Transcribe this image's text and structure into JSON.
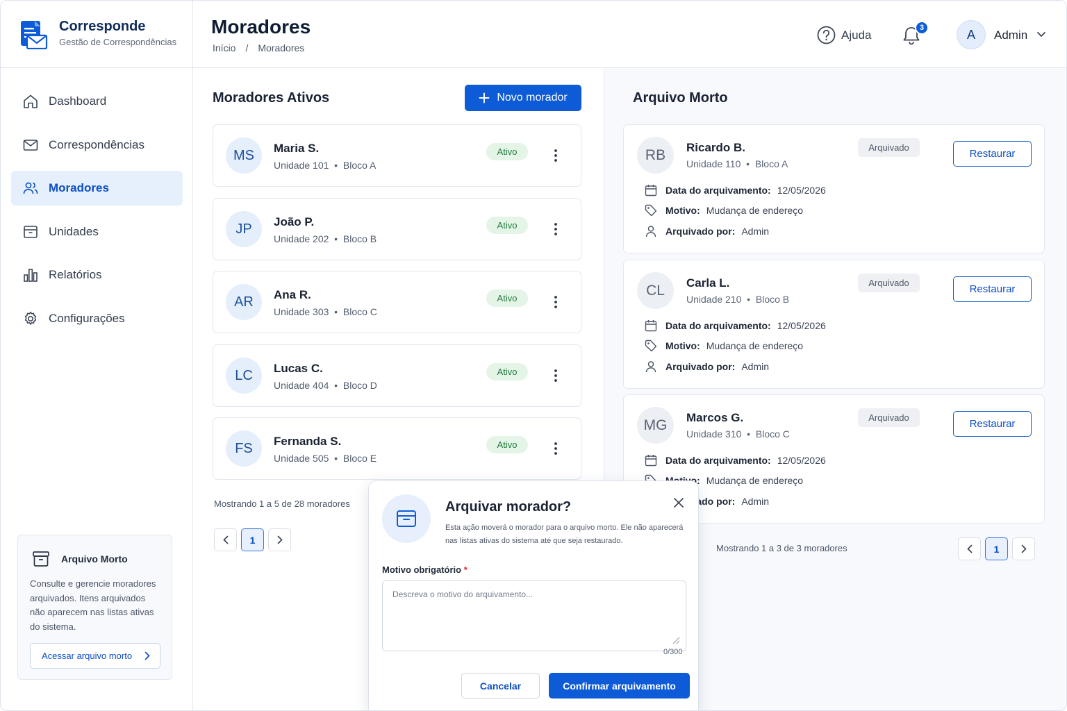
{
  "brand": {
    "name": "Corresponde",
    "subtitle": "Gestão de Correspondências"
  },
  "header": {
    "title": "Moradores",
    "breadcrumb": [
      "Início",
      "/",
      "Moradores"
    ],
    "help_label": "Ajuda",
    "notifications_count": "3",
    "user_initial": "A",
    "user_name": "Admin"
  },
  "sidebar": {
    "items": [
      {
        "label": "Dashboard",
        "icon": "home-icon",
        "active": false
      },
      {
        "label": "Correspondências",
        "icon": "mail-icon",
        "active": false
      },
      {
        "label": "Moradores",
        "icon": "users-icon",
        "active": true
      },
      {
        "label": "Unidades",
        "icon": "box-icon",
        "active": false
      },
      {
        "label": "Relatórios",
        "icon": "bar-chart-icon",
        "active": false
      },
      {
        "label": "Configurações",
        "icon": "gear-icon",
        "active": false
      }
    ],
    "archive_card": {
      "title": "Arquivo Morto",
      "text": "Consulte e gerencie moradores arquivados. Itens arquivados não aparecem nas listas ativas do sistema.",
      "link": "Acessar arquivo morto"
    }
  },
  "active_list": {
    "title": "Moradores Ativos",
    "new_button": "Novo morador",
    "residents": [
      {
        "initials": "MS",
        "name": "Maria S.",
        "unit": "Unidade 101",
        "block": "Bloco A",
        "status": "Ativo"
      },
      {
        "initials": "JP",
        "name": "João P.",
        "unit": "Unidade 202",
        "block": "Bloco B",
        "status": "Ativo"
      },
      {
        "initials": "AR",
        "name": "Ana R.",
        "unit": "Unidade 303",
        "block": "Bloco C",
        "status": "Ativo"
      },
      {
        "initials": "LC",
        "name": "Lucas C.",
        "unit": "Unidade 404",
        "block": "Bloco D",
        "status": "Ativo"
      },
      {
        "initials": "FS",
        "name": "Fernanda S.",
        "unit": "Unidade 505",
        "block": "Bloco E",
        "status": "Ativo"
      }
    ],
    "footer": "Mostrando 1 a 5 de 28 moradores",
    "page": "1"
  },
  "archive": {
    "title": "Arquivo Morto",
    "date_label": "Data do arquivamento:",
    "reason_label": "Motivo:",
    "by_label": "Arquivado por:",
    "badge": "Arquivado",
    "restore_label": "Restaurar",
    "items": [
      {
        "initials": "RB",
        "name": "Ricardo B.",
        "unit": "Unidade 110",
        "block": "Bloco A",
        "date": "12/05/2026",
        "reason": "Mudança de endereço",
        "by": "Admin"
      },
      {
        "initials": "CL",
        "name": "Carla L.",
        "unit": "Unidade 210",
        "block": "Bloco B",
        "date": "12/05/2026",
        "reason": "Mudança de endereço",
        "by": "Admin"
      },
      {
        "initials": "MG",
        "name": "Marcos G.",
        "unit": "Unidade 310",
        "block": "Bloco C",
        "date": "12/05/2026",
        "reason": "Mudança de endereço",
        "by": "Admin"
      }
    ],
    "footer": "Mostrando 1 a 3 de 3 moradores",
    "page": "1"
  },
  "modal": {
    "title": "Arquivar morador?",
    "description": "Esta ação moverá o morador para o arquivo morto. Ele não aparecerá nas listas ativas do sistema até que seja restaurado.",
    "field_label": "Motivo obrigatório",
    "required_mark": "*",
    "placeholder": "Descreva o motivo do arquivamento...",
    "char_count": "0/300",
    "cancel_label": "Cancelar",
    "confirm_label": "Confirmar arquivamento"
  },
  "colors": {
    "primary": "#0d5bd6",
    "active_badge_bg": "#e4f5e8",
    "active_badge_text": "#1f7a3b",
    "nav_active_bg": "#e6f0fd"
  }
}
